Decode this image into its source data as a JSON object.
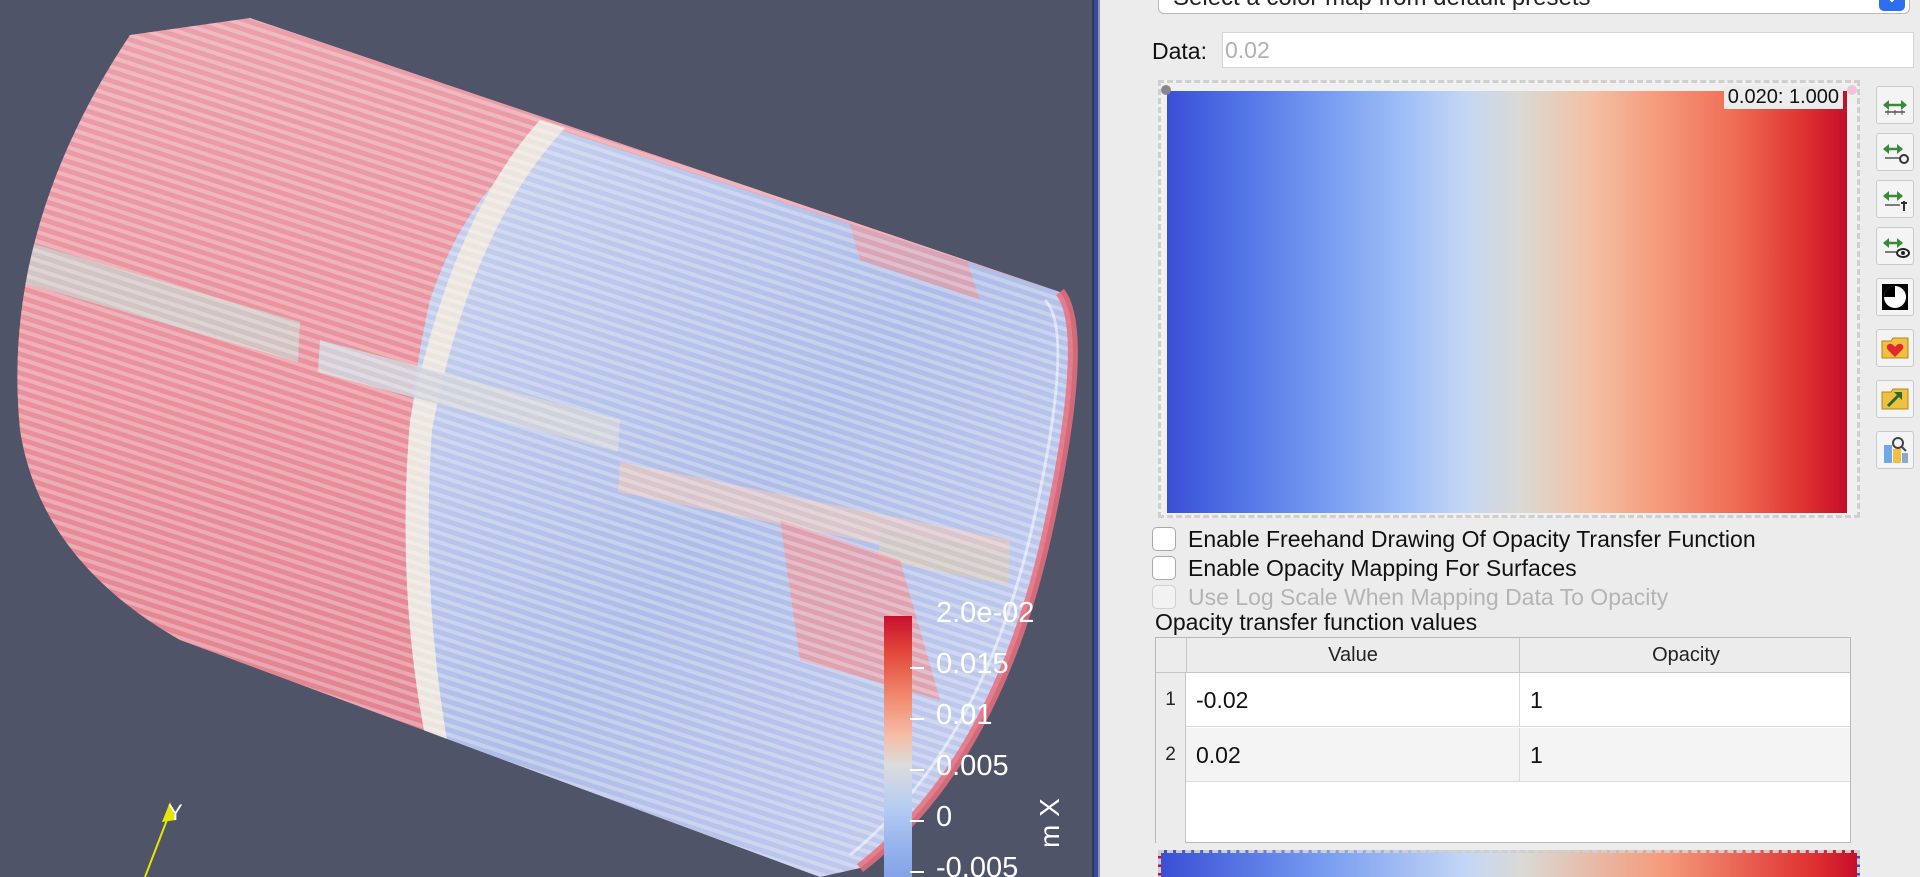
{
  "viewport": {
    "scalar_bar": {
      "labels": [
        "2.0e-02",
        "0.015",
        "0.01",
        "0.005",
        "0",
        "-0.005"
      ],
      "title": "m X"
    },
    "axes": {
      "y_label": "Y"
    }
  },
  "panel": {
    "preset_combo": {
      "label": "Select a color map from default presets"
    },
    "data": {
      "label": "Data:",
      "placeholder": "0.02"
    },
    "transfer_editor": {
      "point_label": "0.020: 1.000"
    },
    "toolbar": {
      "buttons": [
        "rescale-range-icon",
        "rescale-custom-range-icon",
        "rescale-temporal-range-icon",
        "rescale-visible-range-icon",
        "invert-colormap-icon",
        "save-preset-icon",
        "import-preset-icon",
        "choose-preset-icon"
      ]
    },
    "checkboxes": [
      {
        "label": "Enable Freehand Drawing Of Opacity Transfer Function",
        "checked": false,
        "enabled": true
      },
      {
        "label": "Enable Opacity Mapping For Surfaces",
        "checked": false,
        "enabled": true
      },
      {
        "label": "Use Log Scale When Mapping Data To Opacity",
        "checked": false,
        "enabled": false
      }
    ],
    "opacity_table": {
      "title": "Opacity transfer function values",
      "columns": [
        "Value",
        "Opacity"
      ],
      "rows": [
        {
          "index": "1",
          "value": "-0.02",
          "opacity": "1"
        },
        {
          "index": "2",
          "value": "0.02",
          "opacity": "1"
        }
      ]
    }
  }
}
